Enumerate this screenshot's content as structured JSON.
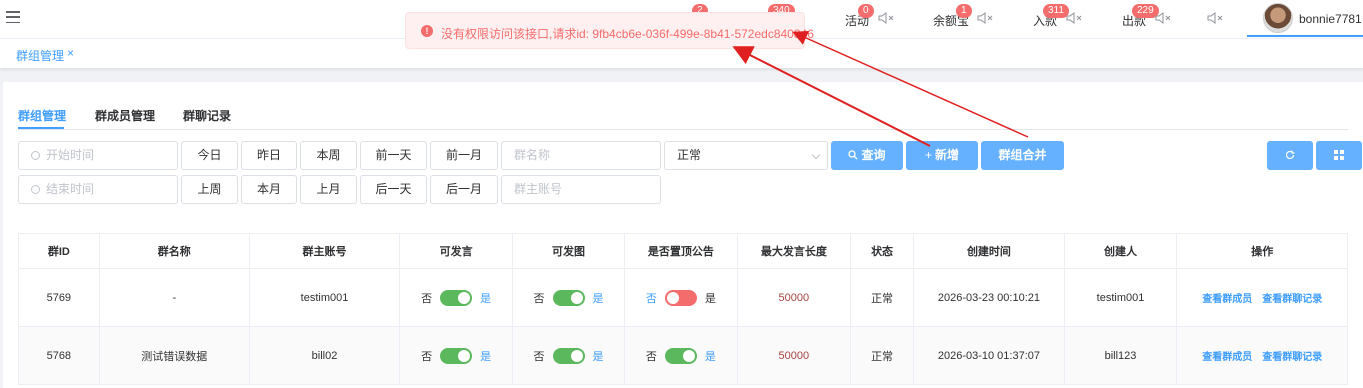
{
  "topbar": {
    "badges": [
      "2",
      "340"
    ],
    "nav": [
      {
        "label": "活动",
        "badge": "0"
      },
      {
        "label": "余额宝",
        "badge": "1"
      },
      {
        "label": "入款",
        "badge": "311"
      },
      {
        "label": "出款",
        "badge": "229"
      }
    ],
    "username": "bonnie7781"
  },
  "tabs": {
    "active": "群组管理",
    "close": "×"
  },
  "toast": {
    "message": "没有权限访问该接口,请求id: 9fb4cb6e-036f-499e-8b41-572edc840846",
    "icon": "!"
  },
  "subtabs": [
    "群组管理",
    "群成员管理",
    "群聊记录"
  ],
  "filters": {
    "start_placeholder": "开始时间",
    "end_placeholder": "结束时间",
    "row1_buttons": [
      "今日",
      "昨日",
      "本周",
      "前一天",
      "前一月"
    ],
    "row2_buttons": [
      "上周",
      "本月",
      "上月",
      "后一天",
      "后一月"
    ],
    "group_name_placeholder": "群名称",
    "owner_placeholder": "群主账号",
    "status_value": "正常",
    "query_label": "查询",
    "add_label": "新增",
    "merge_label": "群组合并"
  },
  "table": {
    "headers": [
      "群ID",
      "群名称",
      "群主账号",
      "可发言",
      "可发图",
      "是否置顶公告",
      "最大发言长度",
      "状态",
      "创建时间",
      "创建人",
      "操作"
    ],
    "switch_no": "否",
    "switch_yes": "是",
    "op_members": "查看群成员",
    "op_chats": "查看群聊记录",
    "rows": [
      {
        "id": "5769",
        "name": "-",
        "owner": "testim001",
        "speak": true,
        "image": true,
        "pin": false,
        "maxlen": "50000",
        "status": "正常",
        "created": "2026-03-23 00:10:21",
        "creator": "testim001"
      },
      {
        "id": "5768",
        "name": "测试错误数据",
        "owner": "bill02",
        "speak": true,
        "image": true,
        "pin": true,
        "maxlen": "50000",
        "status": "正常",
        "created": "2026-03-10 01:37:07",
        "creator": "bill123"
      }
    ]
  },
  "colors": {
    "primary": "#409eff",
    "danger": "#f56c6c",
    "switch_on": "#5cb85c",
    "arrow": "#e02020"
  }
}
